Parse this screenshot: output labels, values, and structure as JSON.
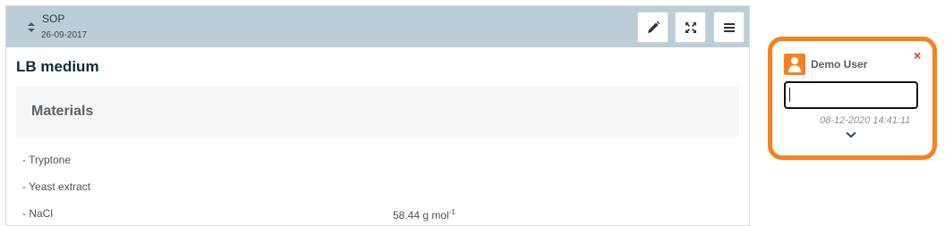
{
  "section": {
    "title": "SOP",
    "date": "26-09-2017",
    "buttons": {
      "edit": "edit-icon",
      "expand": "expand-icon",
      "menu": "menu-icon"
    }
  },
  "document": {
    "title": "LB medium",
    "materials": {
      "heading": "Materials",
      "items": [
        "- Tryptone",
        "- Yeast extract",
        "- NaCl"
      ],
      "nacl_mass_value": "58.44 g mol",
      "nacl_mass_exponent": "-1"
    }
  },
  "comment": {
    "user": "Demo User",
    "input_value": "",
    "timestamp": "08-12-2020 14:41:11",
    "close_symbol": "×"
  },
  "colors": {
    "header_bg": "#bccdd6",
    "accent_orange": "#f7811d",
    "close_red": "#d9342b"
  }
}
